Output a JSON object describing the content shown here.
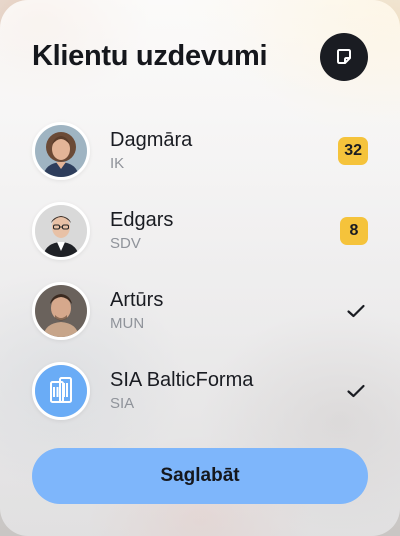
{
  "header": {
    "title": "Klientu uzdevumi",
    "action_icon": "sticky-note-icon"
  },
  "clients": [
    {
      "name": "Dagmāra",
      "type": "IK",
      "trailing": "badge",
      "count": "32"
    },
    {
      "name": "Edgars",
      "type": "SDV",
      "trailing": "badge",
      "count": "8"
    },
    {
      "name": "Artūrs",
      "type": "MUN",
      "trailing": "check"
    },
    {
      "name": "SIA BalticForma",
      "type": "SIA",
      "trailing": "check",
      "avatar_icon": "building-icon"
    }
  ],
  "save_button": {
    "label": "Saglabāt"
  },
  "colors": {
    "accent": "#7eb6fb",
    "badge": "#f5c33b",
    "dark": "#1a1c22",
    "muted": "#8f939a",
    "company_avatar": "#6aacf6"
  }
}
